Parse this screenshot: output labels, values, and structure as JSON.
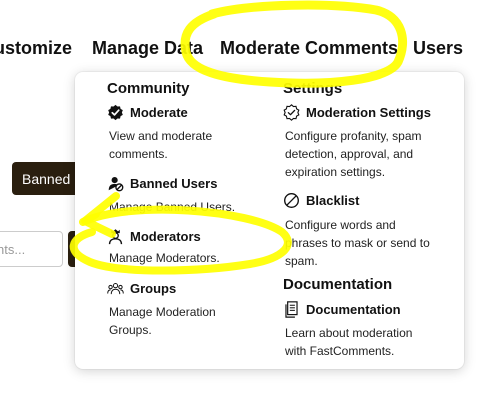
{
  "nav": {
    "items": [
      {
        "label": "ustomize"
      },
      {
        "label": "Manage Data"
      },
      {
        "label": "Moderate Comments"
      },
      {
        "label": "Users"
      }
    ]
  },
  "background": {
    "banned_button": "Banned",
    "search_placeholder": "nts..."
  },
  "dropdown": {
    "community": {
      "title": "Community",
      "items": [
        {
          "title": "Moderate",
          "icon": "check-badge-icon",
          "desc": "View and moderate comments."
        },
        {
          "title": "Banned Users",
          "icon": "banned-user-icon",
          "desc": "Manage Banned Users."
        },
        {
          "title": "Moderators",
          "icon": "moderator-icon",
          "desc": "Manage Moderators."
        },
        {
          "title": "Groups",
          "icon": "groups-icon",
          "desc": "Manage Moderation Groups."
        }
      ]
    },
    "settings": {
      "title": "Settings",
      "items": [
        {
          "title": "Moderation Settings",
          "icon": "settings-badge-icon",
          "desc": "Configure profanity, spam detection, approval, and expiration settings."
        },
        {
          "title": "Blacklist",
          "icon": "blacklist-icon",
          "desc": "Configure words and phrases to mask or send to spam."
        }
      ]
    },
    "documentation": {
      "title": "Documentation",
      "items": [
        {
          "title": "Documentation",
          "icon": "document-icon",
          "desc": "Learn about moderation with FastComments."
        }
      ]
    }
  },
  "colors": {
    "highlight": "#ffff00",
    "dark_button": "#2a1f0f"
  }
}
